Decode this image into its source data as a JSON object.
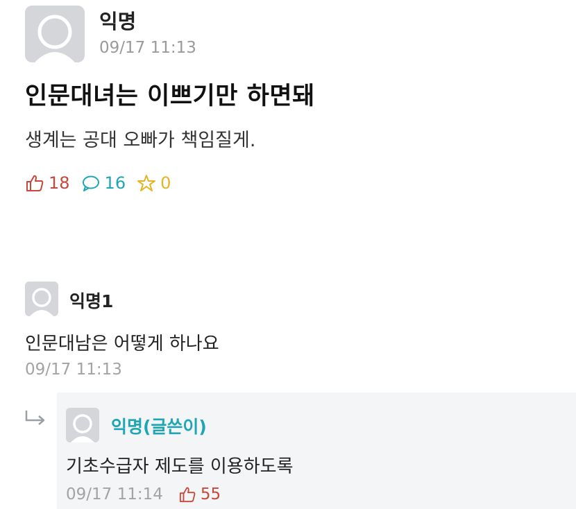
{
  "post": {
    "author": "익명",
    "time": "09/17 11:13",
    "title": "인문대녀는 이쁘기만 하면돼",
    "body": "생계는 공대 오빠가 책임질게.",
    "stats": {
      "likes": "18",
      "comments": "16",
      "scraps": "0"
    }
  },
  "comments": [
    {
      "author": "익명1",
      "body": "인문대남은 어떻게 하나요",
      "time": "09/17 11:13"
    }
  ],
  "reply": {
    "author": "익명(글쓴이)",
    "body": "기초수급자 제도를 이용하도록",
    "time": "09/17 11:14",
    "likes": "55"
  },
  "colors": {
    "like": "#c8473a",
    "comment": "#1fa6b4",
    "scrap": "#e6b422",
    "writer": "#1fa6b4"
  },
  "icons": {
    "like": "thumbs-up-icon",
    "comment": "speech-bubble-icon",
    "scrap": "star-icon",
    "reply": "reply-arrow-icon",
    "avatar": "default-avatar-icon"
  }
}
